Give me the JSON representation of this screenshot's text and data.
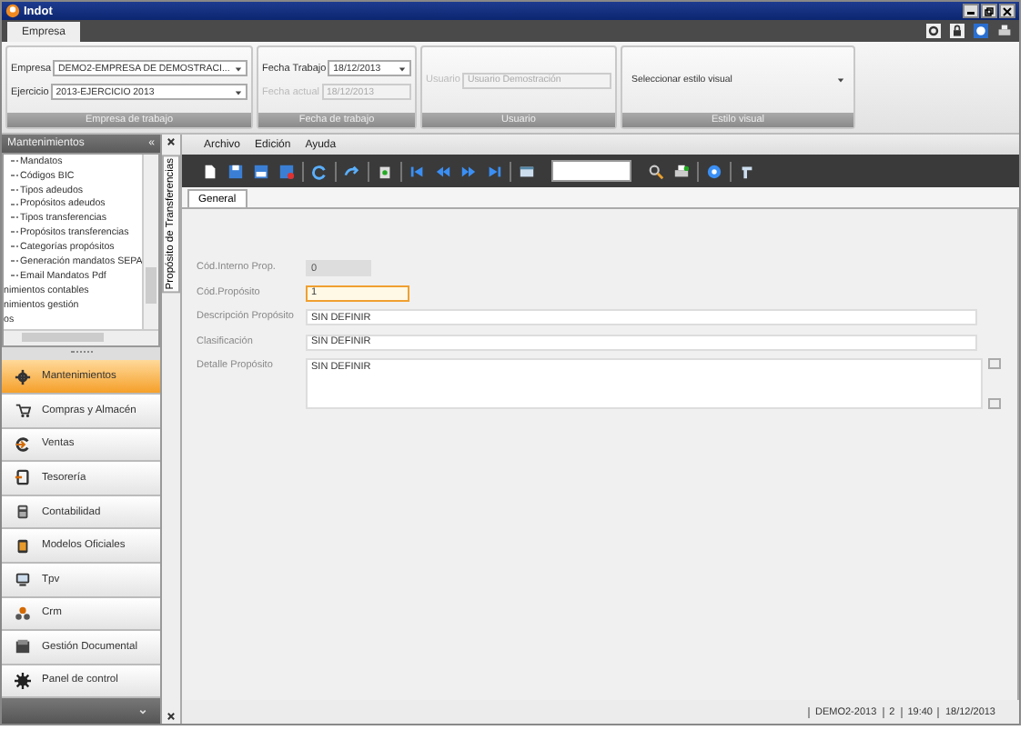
{
  "window": {
    "title": "Indot"
  },
  "ribbon_tabs": [
    {
      "label": "Empresa",
      "selected": true
    }
  ],
  "ribbon_groups": [
    {
      "title": "Empresa de trabajo",
      "fields": [
        {
          "label": "Empresa",
          "value": "DEMO2-EMPRESA DE DEMOSTRACI...",
          "kind": "combo",
          "disabled": false
        },
        {
          "label": "Ejercicio",
          "value": "2013-EJERCICIO 2013",
          "kind": "combo",
          "disabled": false
        }
      ]
    },
    {
      "title": "Fecha de trabajo",
      "fields": [
        {
          "label": "Fecha Trabajo",
          "value": "18/12/2013",
          "kind": "combo",
          "disabled": false
        },
        {
          "label": "Fecha actual",
          "value": "18/12/2013",
          "kind": "text",
          "disabled": true
        }
      ]
    },
    {
      "title": "Usuario",
      "fields": [
        {
          "label": "Usuario",
          "value": "Usuario Demostración",
          "kind": "text",
          "disabled": true
        }
      ]
    },
    {
      "title": "Estilo visual",
      "fields": [
        {
          "value": "Seleccionar estilo visual",
          "kind": "combo",
          "disabled": false
        }
      ]
    }
  ],
  "sidebar": {
    "title": "Mantenimientos",
    "collapse": "«",
    "tree": [
      {
        "label": "Mandatos",
        "kind": "leaf"
      },
      {
        "label": "Códigos BIC",
        "kind": "leaf"
      },
      {
        "label": "Tipos adeudos",
        "kind": "leaf"
      },
      {
        "label": "Propósitos adeudos",
        "kind": "leaf"
      },
      {
        "label": "Tipos transferencias",
        "kind": "leaf"
      },
      {
        "label": "Propósitos transferencias",
        "kind": "leaf"
      },
      {
        "label": "Categorías propósitos",
        "kind": "leaf"
      },
      {
        "label": "Generación mandatos SEPA",
        "kind": "leaf"
      },
      {
        "label": "Email Mandatos Pdf",
        "kind": "leaf"
      },
      {
        "label": "nimientos contables",
        "kind": "root"
      },
      {
        "label": "nimientos gestión",
        "kind": "root"
      },
      {
        "label": "os",
        "kind": "root"
      }
    ],
    "modules": [
      {
        "label": "Mantenimientos",
        "selected": true
      },
      {
        "label": "Compras y Almacén",
        "selected": false
      },
      {
        "label": "Ventas",
        "selected": false
      },
      {
        "label": "Tesorería",
        "selected": false
      },
      {
        "label": "Contabilidad",
        "selected": false
      },
      {
        "label": "Modelos Oficiales",
        "selected": false
      },
      {
        "label": "Tpv",
        "selected": false
      },
      {
        "label": "Crm",
        "selected": false
      },
      {
        "label": "Gestión Documental",
        "selected": false
      },
      {
        "label": "Panel de control",
        "selected": false
      }
    ]
  },
  "document_tab": {
    "title": "Propósito de Transferencias"
  },
  "menu": [
    "Archivo",
    "Edición",
    "Ayuda"
  ],
  "form_tabs": [
    {
      "label": "General",
      "selected": true
    }
  ],
  "form": [
    {
      "label": "Cód.Interno Prop.",
      "value": "0",
      "kind": "short",
      "disabled": true,
      "focused": false
    },
    {
      "label": "Cód.Propósito",
      "value": "1",
      "kind": "short",
      "disabled": false,
      "focused": true
    },
    {
      "label": "Descripción Propósito",
      "value": "SIN DEFINIR",
      "kind": "wide",
      "disabled": false,
      "focused": false
    },
    {
      "label": "Clasificación",
      "value": "SIN DEFINIR",
      "kind": "wide",
      "disabled": false,
      "focused": false
    },
    {
      "label": "Detalle Propósito",
      "value": "SIN DEFINIR",
      "kind": "multiline",
      "disabled": false,
      "focused": false
    }
  ],
  "status_bar": [
    "DEMO2-2013",
    "2",
    "19:40",
    "18/12/2013"
  ]
}
